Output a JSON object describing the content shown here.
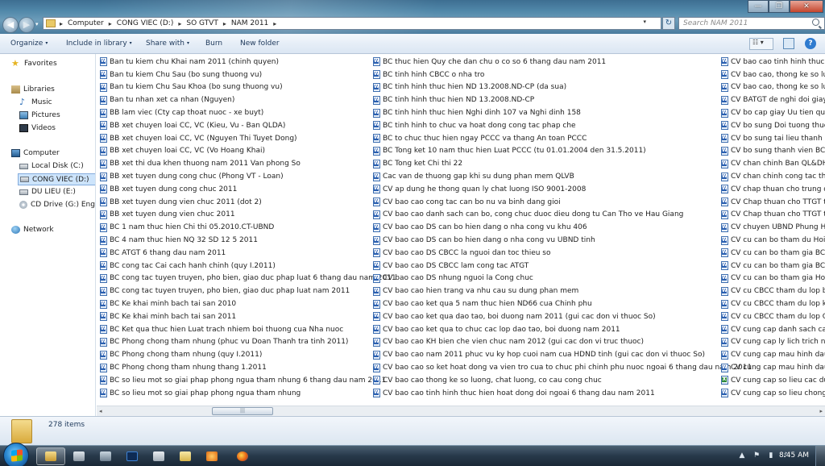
{
  "window": {
    "minimize": "—",
    "maximize": "❐",
    "close": "✕"
  },
  "address": {
    "crumbs": [
      "Computer",
      "CONG VIEC (D:)",
      "SO GTVT",
      "NAM 2011"
    ],
    "separator": "▸",
    "search_placeholder": "Search NAM 2011"
  },
  "toolbar": {
    "organize": "Organize",
    "include_in_library": "Include in library",
    "share_with": "Share with",
    "burn": "Burn",
    "new_folder": "New folder",
    "dropdown": "▾"
  },
  "nav": {
    "favorites": "Favorites",
    "libraries": "Libraries",
    "music": "Music",
    "pictures": "Pictures",
    "videos": "Videos",
    "computer": "Computer",
    "local_disk": "Local Disk (C:)",
    "cong_viec": "CONG VIEC (D:)",
    "du_lieu": "DU LIEU (E:)",
    "cd_drive": "CD Drive (G:) EngStc",
    "network": "Network"
  },
  "files": {
    "col1": [
      "Ban tu kiem chu Khai nam 2011 (chinh quyen)",
      "Ban tu kiem Chu Sau (bo sung thuong vu)",
      "Ban tu kiem Chu Sau Khoa (bo sung thuong vu)",
      "Ban tu nhan xet ca nhan (Nguyen)",
      "BB lam viec (Cty cap thoat nuoc - xe buyt)",
      "BB xet chuyen loai CC, VC (Kieu, Vu - Ban QLDA)",
      "BB xet chuyen loai CC, VC (Nguyen Thi Tuyet Dong)",
      "BB xet chuyen loai CC, VC (Vo Hoang Khai)",
      "BB xet thi dua khen thuong nam 2011 Van phong So",
      "BB xet tuyen dung cong chuc (Phong VT - Loan)",
      "BB xet tuyen dung cong chuc 2011",
      "BB xet tuyen dung vien chuc 2011 (dot 2)",
      "BB xet tuyen dung vien chuc 2011",
      "BC 1 nam thuc hien Chi thi 05.2010.CT-UBND",
      "BC 4 nam  thuc hien NQ 32 SD 12 5 2011",
      "BC ATGT 6 thang dau nam 2011",
      "BC cong tac Cai cach hanh chinh (quy I.2011)",
      "BC cong tac tuyen truyen, pho bien, giao duc phap luat 6 thang dau nam 2011",
      "BC cong tac tuyen truyen, pho bien, giao duc phap luat nam 2011",
      "BC Ke khai minh bach tai san 2010",
      "BC Ke khai minh bach tai san 2011",
      "BC Ket qua thuc hien Luat trach nhiem boi thuong cua Nha nuoc",
      "BC Phong chong tham nhung (phuc vu Doan Thanh tra tinh 2011)",
      "BC Phong chong tham nhung (quy I.2011)",
      "BC Phong chong tham nhung thang 1.2011",
      "BC so lieu mot so giai phap phong ngua tham nhung 6 thang dau nam 2011",
      "BC so lieu mot so giai phap phong ngua tham nhung"
    ],
    "col2": [
      "BC thuc hien Quy che dan chu o co so 6 thang dau nam 2011",
      "BC tinh hinh CBCC o nha tro",
      "BC tinh hinh thuc hien ND 13.2008.ND-CP (da sua)",
      "BC tinh hinh thuc hien ND 13.2008.ND-CP",
      "BC tinh hinh thuc hien Nghi dinh 107 va Nghi dinh 158",
      "BC tinh hinh to chuc va hoat dong cong tac phap che",
      "BC to chuc thuc hien ngay PCCC va thang An toan PCCC",
      "BC Tong ket 10 nam thuc hien Luat PCCC (tu 01.01.2004 den 31.5.2011)",
      "BC Tong ket Chi thi 22",
      "Cac van de thuong gap khi su dung phan mem QLVB",
      "CV ap dung he thong quan ly chat luong ISO 9001-2008",
      "CV bao cao cong tac can bo nu va binh dang gioi",
      "CV bao cao danh sach can bo, cong chuc duoc dieu dong tu Can Tho ve Hau Giang",
      "CV bao cao DS can bo hien dang o nha cong vu khu 406",
      "CV bao cao DS can bo hien dang o nha cong vu UBND tinh",
      "CV bao cao DS CBCC la nguoi dan toc thieu so",
      "CV bao cao DS CBCC lam cong tac ATGT",
      "CV bao cao DS nhung nguoi la Cong chuc",
      "CV bao cao hien trang va nhu cau su dung phan mem",
      "CV bao cao ket qua 5 nam thuc hien ND66 cua Chinh phu",
      "CV bao cao ket qua dao tao, boi duong nam 2011 (gui cac don vi thuoc So)",
      "CV bao cao ket qua to chuc cac lop dao tao, boi duong nam 2011",
      "CV bao cao KH bien che vien chuc nam 2012 (gui cac don vi truc thuoc)",
      "CV bao cao nam 2011 phuc vu ky hop cuoi nam cua HDND tinh (gui cac don vi thuoc So)",
      "CV bao cao so ket hoat dong va vien tro cua to chuc phi chinh phu nuoc ngoai 6 thang dau nam 2011",
      "CV bao cao thong ke so luong, chat luong, co cau cong chuc",
      "CV bao cao tinh hinh thuc hien hoat dong doi ngoai 6 thang dau nam 2011"
    ],
    "col3": [
      "CV bao cao tinh hinh thuc hien",
      "CV bao cao, thong ke so luong",
      "CV bao cao, thong ke so luong",
      "CV BATGT de nghi doi giay ph",
      "CV bo cap giay Uu tien qua ph",
      "CV bo sung Doi tuong thuoc",
      "CV bo sung tai lieu thanh lap",
      "CV bo sung thanh vien BCD 1",
      "CV chan chinh Ban QL&DH B",
      "CV chan chinh cong tac thong",
      "CV chap thuan cho trung dun",
      "CV Chap thuan cho TTGT tha",
      "CV Chap thuan cho TTGT tha",
      "CV chuyen UBND Phung Hiep",
      "CV cu can bo tham du Hoi ng",
      "CV cu can bo tham gia BCD q",
      "CV cu can bo tham gia BCD g",
      "CV cu can bo tham gia Hoi d",
      "CV cu CBCC tham du lop boi",
      "CV cu CBCC tham du lop ky n",
      "CV cu CBCC tham du lop Qua",
      "CV cung cap danh sach can b",
      "CV cung cap ly lich trich nga",
      "CV cung cap mau hinh dau v",
      "CV cung cap mau hinh dau v",
      "CV cung cap so lieu cac du a",
      "CV cung cap so lieu chong n"
    ]
  },
  "scrollbar": {
    "left": "◂",
    "right": "▸",
    "grip": "|||"
  },
  "status": {
    "items_count": "278 items"
  },
  "taskbar": {
    "time": "8:45 AM",
    "tray": [
      "▲",
      "⚑",
      "▮",
      "♪"
    ]
  },
  "colors": {
    "accent": "#1e395b",
    "selection": "#cde4fb",
    "word_icon": "#2a5fb0",
    "excel_icon": "#2d8b3a"
  }
}
